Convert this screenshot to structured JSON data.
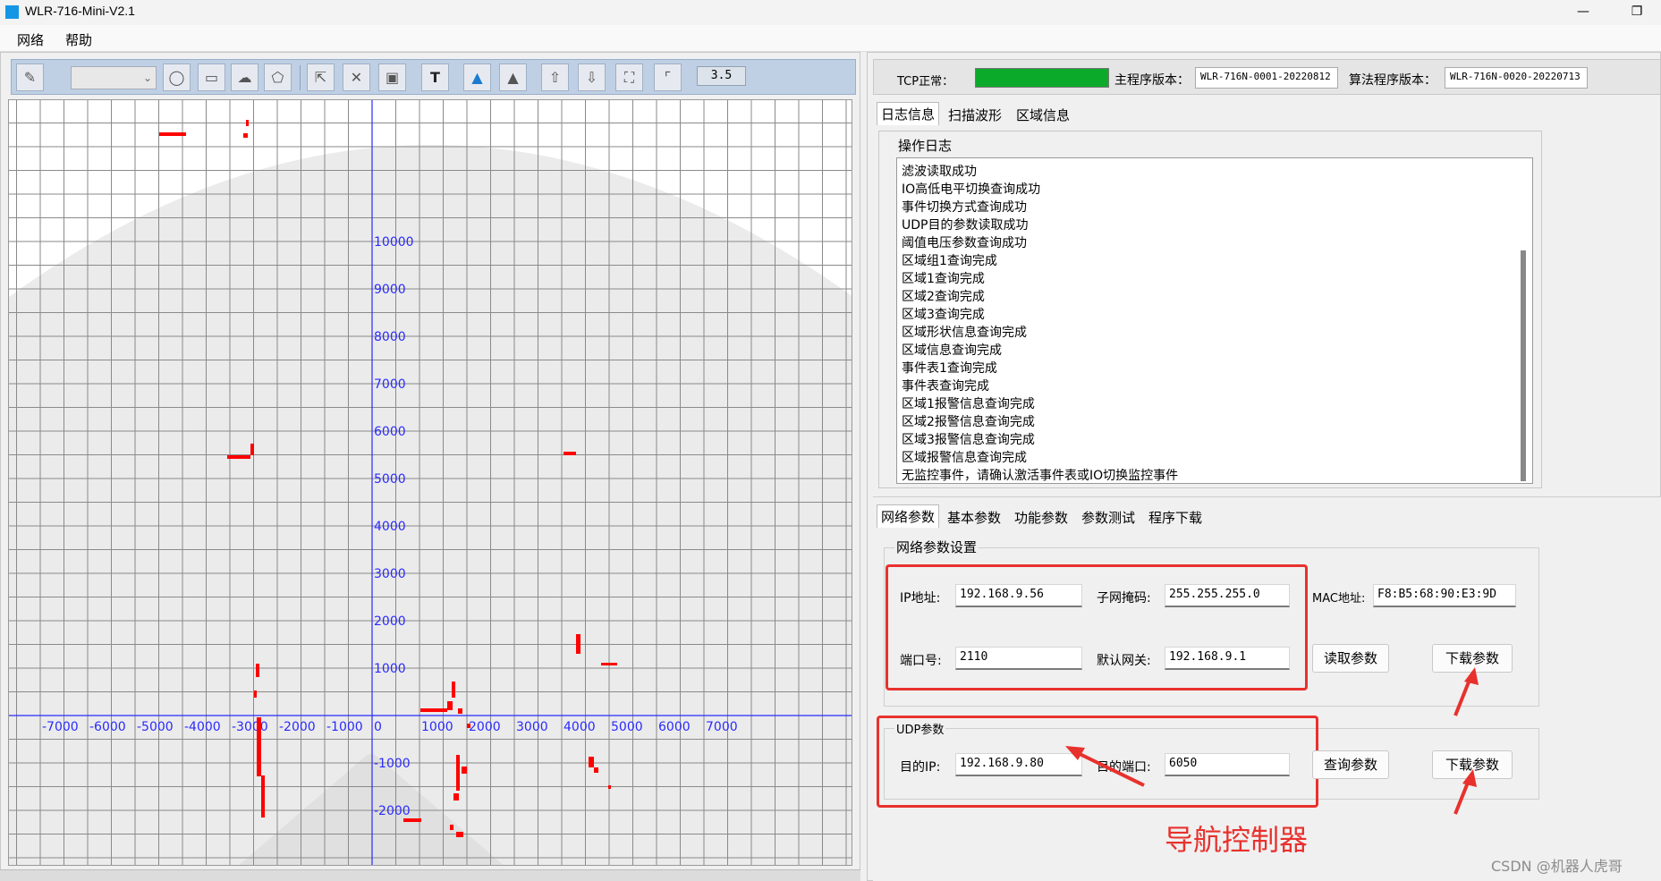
{
  "window": {
    "title": "WLR-716-Mini-V2.1",
    "minimize": "—",
    "maximize": "❐"
  },
  "menu": {
    "items": [
      "网络",
      "帮助"
    ]
  },
  "toolbar": {
    "zoom_value": "3.5"
  },
  "plot": {
    "x_ticks": [
      "-7000",
      "-6000",
      "-5000",
      "-4000",
      "-3000",
      "-2000",
      "-1000",
      "0",
      "1000",
      "2000",
      "3000",
      "4000",
      "5000",
      "6000",
      "7000"
    ],
    "y_ticks": [
      "10000",
      "9000",
      "8000",
      "7000",
      "6000",
      "5000",
      "4000",
      "3000",
      "2000",
      "1000",
      "-1000",
      "-2000"
    ]
  },
  "status": {
    "tcp_label": "TCP正常：",
    "tcp_color": "#0caa2a",
    "main_version_label": "主程序版本：",
    "main_version_value": "WLR-716N-0001-20220812",
    "algo_version_label": "算法程序版本：",
    "algo_version_value": "WLR-716N-0020-20220713"
  },
  "top_tabs": [
    "日志信息",
    "扫描波形",
    "区域信息"
  ],
  "log": {
    "group_title": "操作日志",
    "lines": [
      "滤波读取成功",
      "IO高低电平切换查询成功",
      "事件切换方式查询成功",
      "UDP目的参数读取成功",
      "阈值电压参数查询成功",
      "区域组1查询完成",
      "区域1查询完成",
      "区域2查询完成",
      "区域3查询完成",
      "区域形状信息查询完成",
      "区域信息查询完成",
      "事件表1查询完成",
      "事件表查询完成",
      "区域1报警信息查询完成",
      "区域2报警信息查询完成",
      "区域3报警信息查询完成",
      "区域报警信息查询完成",
      "无监控事件，请确认激活事件表或IO切换监控事件"
    ]
  },
  "bottom_tabs": [
    "网络参数",
    "基本参数",
    "功能参数",
    "参数测试",
    "程序下载"
  ],
  "network": {
    "group_title": "网络参数设置",
    "ip_label": "IP地址:",
    "ip_value": "192.168.9.56",
    "mask_label": "子网掩码:",
    "mask_value": "255.255.255.0",
    "mac_label": "MAC地址:",
    "mac_value": "F8:B5:68:90:E3:9D",
    "port_label": "端口号:",
    "port_value": "2110",
    "gateway_label": "默认网关:",
    "gateway_value": "192.168.9.1",
    "read_button": "读取参数",
    "download_button": "下载参数"
  },
  "udp": {
    "group_title": "UDP参数",
    "dest_ip_label": "目的IP:",
    "dest_ip_value": "192.168.9.80",
    "dest_port_label": "目的端口:",
    "dest_port_value": "6050",
    "query_button": "查询参数",
    "download_button": "下载参数"
  },
  "annotation": {
    "text": "导航控制器",
    "color": "#e8312d"
  },
  "watermark": "CSDN @机器人虎哥"
}
